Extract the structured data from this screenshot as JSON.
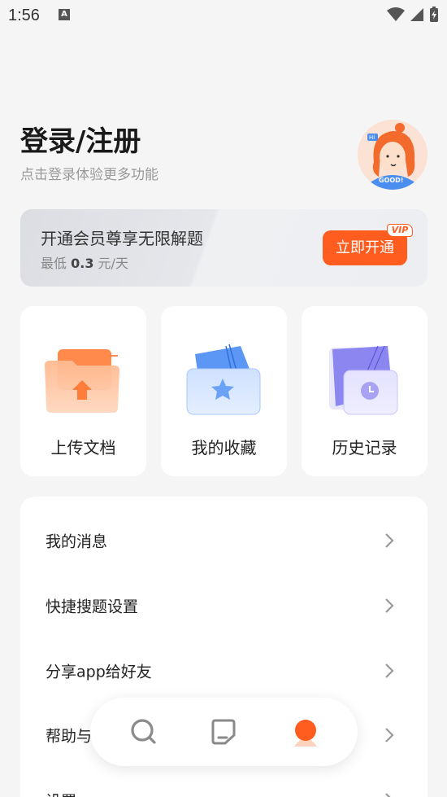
{
  "status_bar": {
    "time": "1:56",
    "notification_icon_letter": "A"
  },
  "header": {
    "title": "登录/注册",
    "subtitle": "点击登录体验更多功能"
  },
  "vip": {
    "title": "开通会员尊享无限解题",
    "price_prefix": "最低",
    "price_value": "0.3",
    "price_unit": "元/天",
    "button_label": "立即开通",
    "tag": "VIP",
    "accent_color": "#ff5c1f"
  },
  "quick_actions": [
    {
      "label": "上传文档",
      "icon": "upload-folder-icon"
    },
    {
      "label": "我的收藏",
      "icon": "star-folder-icon"
    },
    {
      "label": "历史记录",
      "icon": "history-clock-icon"
    }
  ],
  "menu": [
    {
      "label": "我的消息"
    },
    {
      "label": "快捷搜题设置"
    },
    {
      "label": "分享app给好友"
    },
    {
      "label": "帮助与"
    },
    {
      "label": "设置"
    }
  ],
  "bottom_nav": [
    {
      "icon": "search-icon"
    },
    {
      "icon": "document-icon"
    },
    {
      "icon": "profile-icon",
      "active": true
    }
  ]
}
